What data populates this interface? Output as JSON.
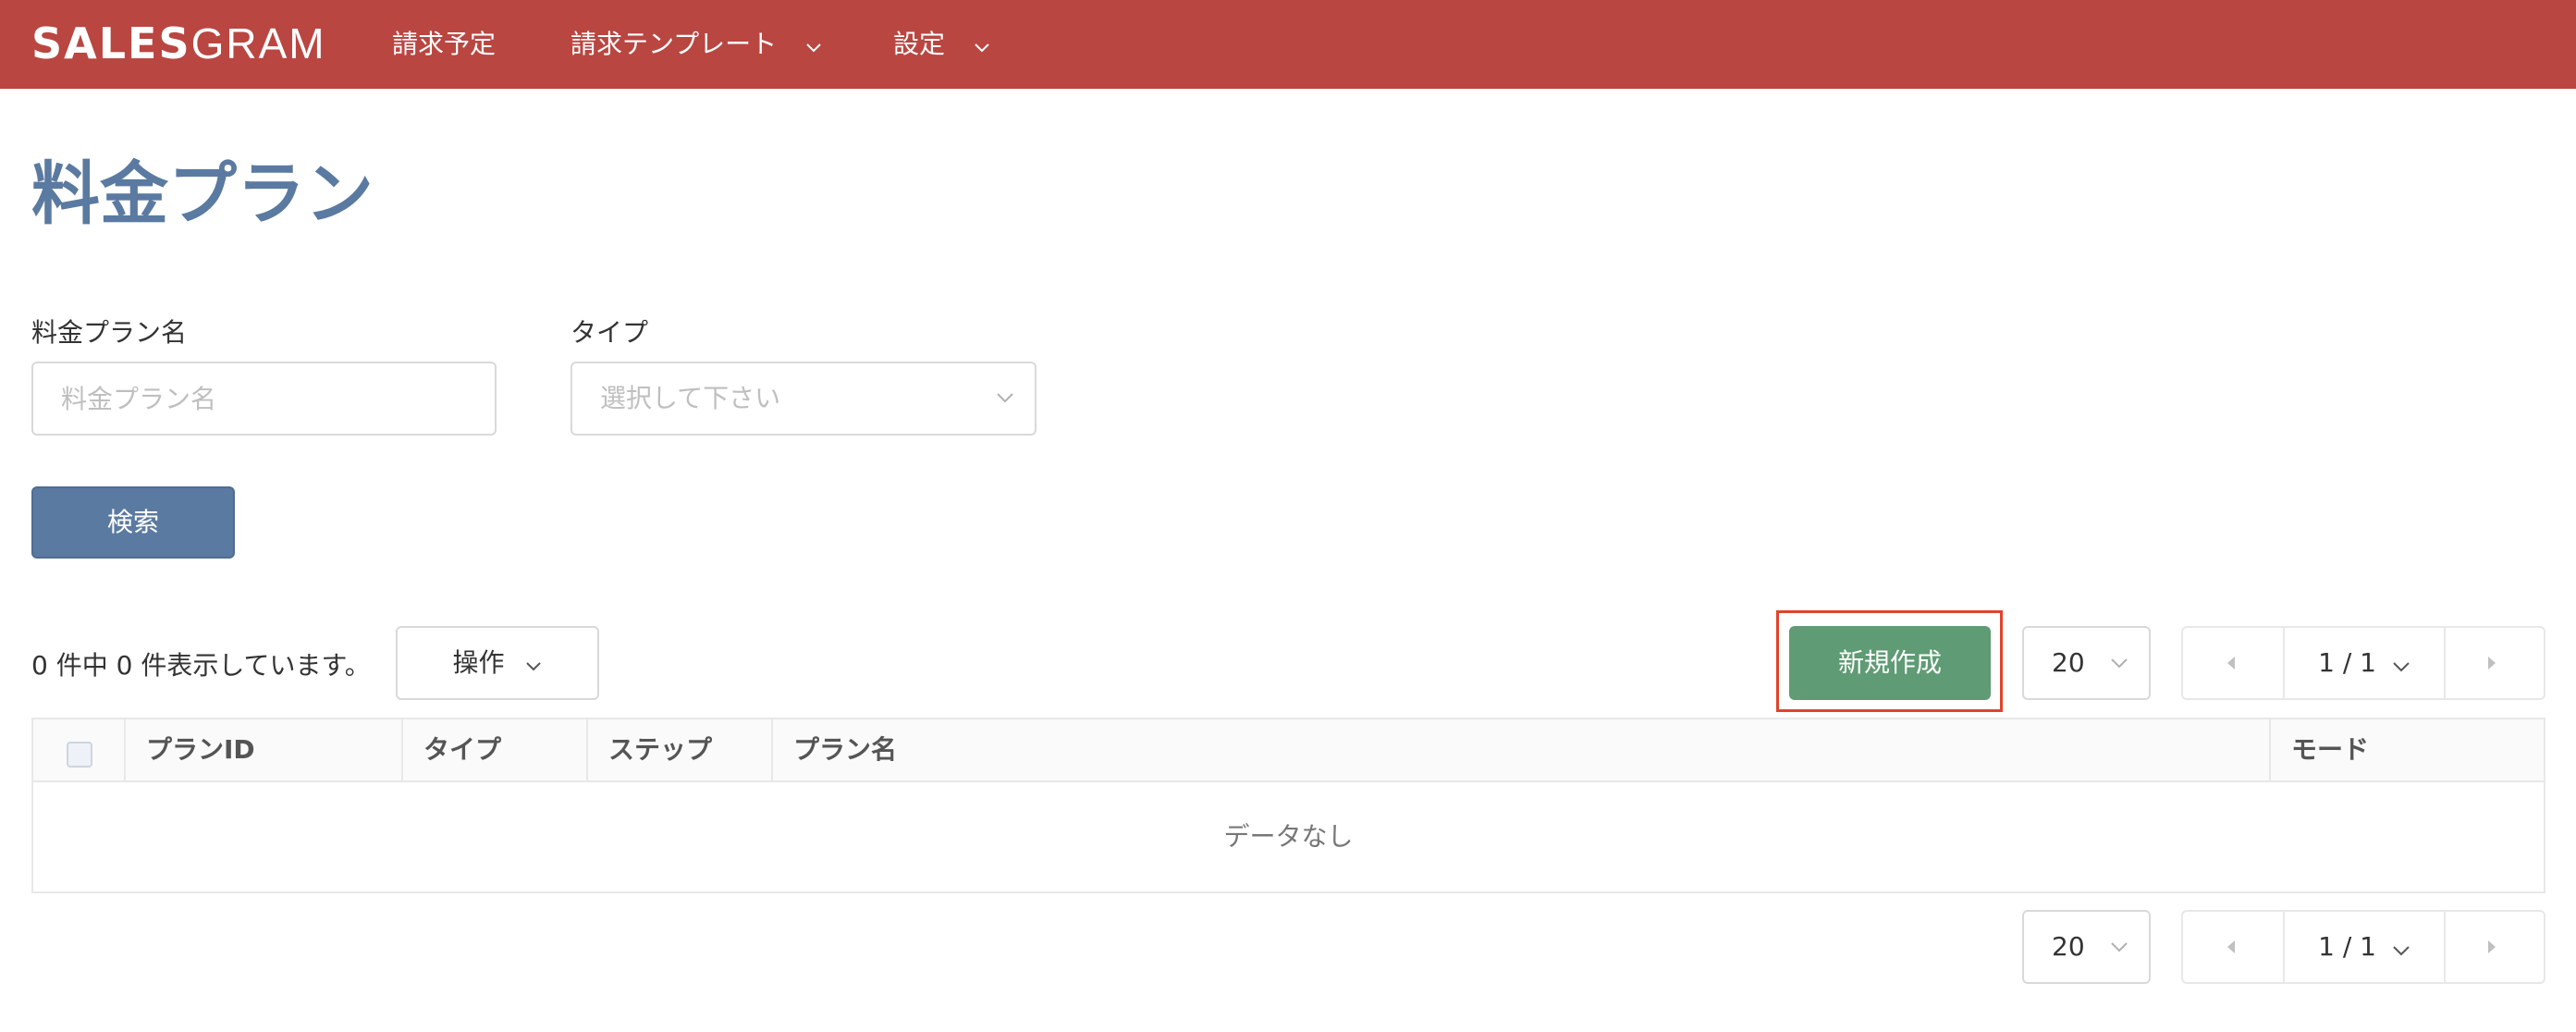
{
  "header": {
    "logo_bold": "SALES",
    "logo_thin": "GRAM",
    "nav": [
      {
        "label": "請求予定"
      },
      {
        "label": "請求テンプレート"
      },
      {
        "label": "設定"
      }
    ]
  },
  "page": {
    "title": "料金プラン"
  },
  "filters": {
    "plan_name_label": "料金プラン名",
    "plan_name_placeholder": "料金プラン名",
    "type_label": "タイプ",
    "type_placeholder": "選択して下さい",
    "search_label": "検索"
  },
  "toolbar": {
    "count_text": "0 件中 0 件表示しています。",
    "ops_label": "操作",
    "new_label": "新規作成",
    "page_size": "20",
    "page_indicator": "1 / 1"
  },
  "table": {
    "columns": [
      "プランID",
      "タイプ",
      "ステップ",
      "プラン名",
      "モード"
    ],
    "empty_text": "データなし"
  },
  "footer_pager": {
    "page_size": "20",
    "page_indicator": "1 / 1"
  },
  "colors": {
    "header_bg": "#b94641",
    "title": "#5b7aa1",
    "search_button": "#5b7aa1",
    "new_button": "#5f9b74",
    "highlight": "#e0432c"
  }
}
